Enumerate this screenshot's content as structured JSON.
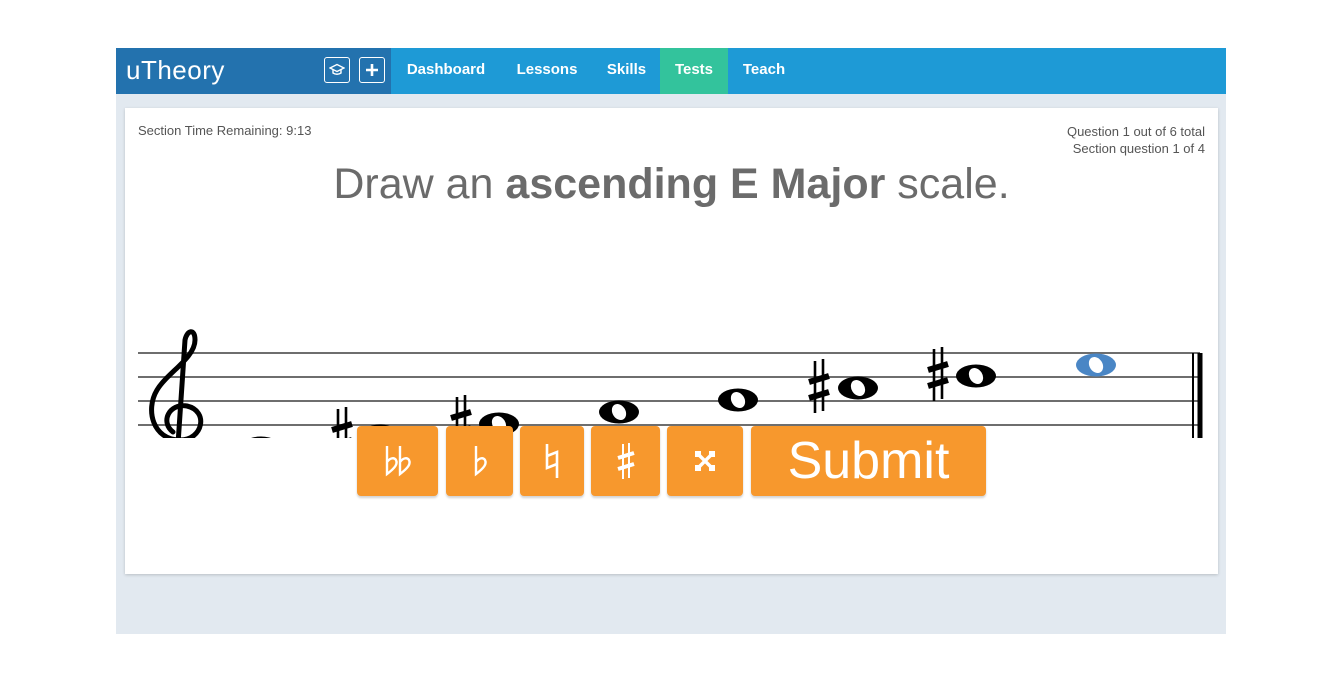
{
  "header": {
    "logo": "uTheory",
    "nav": [
      "Dashboard",
      "Lessons",
      "Skills",
      "Tests",
      "Teach"
    ],
    "active_tab": "Tests"
  },
  "icons": [
    "graduation-cap-icon",
    "plus-icon",
    "treble-clef-icon",
    "sharp-icon",
    "whole-note-icon"
  ],
  "test": {
    "time_remaining": "Section Time Remaining: 9:13",
    "question_total": "Question 1 out of 6 total",
    "section_question": "Section question 1 of 4",
    "prompt_pre": "Draw an ",
    "prompt_bold": "ascending E Major",
    "prompt_post": " scale."
  },
  "toolbar": {
    "buttons": [
      "double-flat",
      "flat",
      "natural",
      "sharp",
      "double-sharp"
    ],
    "submit_label": "Submit"
  },
  "colors": {
    "nav_bg": "#1e9ad6",
    "brand_bg": "#2372ae",
    "active_tab": "#33c39c",
    "accent_orange": "#f7982d",
    "pending_note": "#4a86c5"
  }
}
